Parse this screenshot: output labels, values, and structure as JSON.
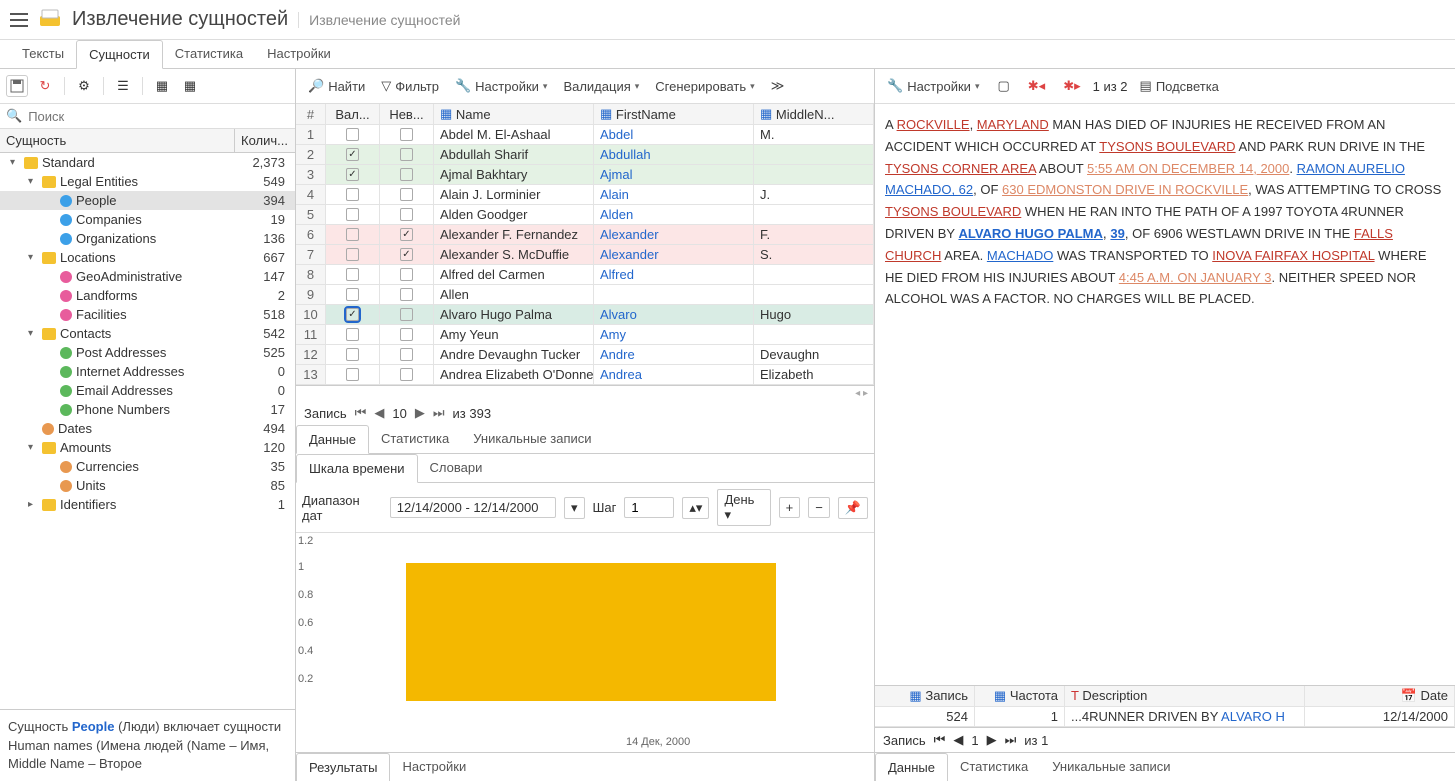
{
  "app": {
    "title": "Извлечение сущностей",
    "subtitle": "Извлечение сущностей"
  },
  "main_tabs": [
    "Тексты",
    "Сущности",
    "Статистика",
    "Настройки"
  ],
  "main_tab_active": 1,
  "sidebar": {
    "search_placeholder": "Поиск",
    "header_entity": "Сущность",
    "header_count": "Колич...",
    "tree": [
      {
        "indent": 0,
        "chev": "▾",
        "icon": "folder",
        "label": "Standard",
        "count": "2,373"
      },
      {
        "indent": 1,
        "chev": "▾",
        "icon": "folder",
        "label": "Legal Entities",
        "count": "549"
      },
      {
        "indent": 2,
        "chev": "",
        "icon": "dot",
        "color": "#3ca0e8",
        "label": "People",
        "count": "394",
        "sel": true
      },
      {
        "indent": 2,
        "chev": "",
        "icon": "dot",
        "color": "#3ca0e8",
        "label": "Companies",
        "count": "19"
      },
      {
        "indent": 2,
        "chev": "",
        "icon": "dot",
        "color": "#3ca0e8",
        "label": "Organizations",
        "count": "136"
      },
      {
        "indent": 1,
        "chev": "▾",
        "icon": "folder",
        "label": "Locations",
        "count": "667"
      },
      {
        "indent": 2,
        "chev": "",
        "icon": "dot",
        "color": "#e85c9c",
        "label": "GeoAdministrative",
        "count": "147"
      },
      {
        "indent": 2,
        "chev": "",
        "icon": "dot",
        "color": "#e85c9c",
        "label": "Landforms",
        "count": "2"
      },
      {
        "indent": 2,
        "chev": "",
        "icon": "dot",
        "color": "#e85c9c",
        "label": "Facilities",
        "count": "518"
      },
      {
        "indent": 1,
        "chev": "▾",
        "icon": "folder",
        "label": "Contacts",
        "count": "542"
      },
      {
        "indent": 2,
        "chev": "",
        "icon": "dot",
        "color": "#5cb85c",
        "label": "Post Addresses",
        "count": "525"
      },
      {
        "indent": 2,
        "chev": "",
        "icon": "dot",
        "color": "#5cb85c",
        "label": "Internet Addresses",
        "count": "0"
      },
      {
        "indent": 2,
        "chev": "",
        "icon": "dot",
        "color": "#5cb85c",
        "label": "Email Addresses",
        "count": "0"
      },
      {
        "indent": 2,
        "chev": "",
        "icon": "dot",
        "color": "#5cb85c",
        "label": "Phone Numbers",
        "count": "17"
      },
      {
        "indent": 1,
        "chev": "",
        "icon": "dot",
        "color": "#e89850",
        "label": "Dates",
        "count": "494"
      },
      {
        "indent": 1,
        "chev": "▾",
        "icon": "folder",
        "label": "Amounts",
        "count": "120"
      },
      {
        "indent": 2,
        "chev": "",
        "icon": "dot",
        "color": "#e89850",
        "label": "Currencies",
        "count": "35"
      },
      {
        "indent": 2,
        "chev": "",
        "icon": "dot",
        "color": "#e89850",
        "label": "Units",
        "count": "85"
      },
      {
        "indent": 1,
        "chev": "▸",
        "icon": "folder",
        "label": "Identifiers",
        "count": "1"
      }
    ],
    "desc_prefix": "Сущность ",
    "desc_keyword": "People",
    "desc_suffix": " (Люди) включает сущности Human names (Имена людей (Name – Имя, Middle Name – Второе"
  },
  "center_toolbar": {
    "find": "Найти",
    "filter": "Фильтр",
    "settings": "Настройки",
    "validation": "Валидация",
    "generate": "Сгенерировать"
  },
  "grid": {
    "headers": {
      "num": "#",
      "val": "Вал...",
      "nev": "Нев...",
      "name": "Name",
      "first": "FirstName",
      "mid": "MiddleN..."
    },
    "rows": [
      {
        "n": "1",
        "v": false,
        "nv": false,
        "name": "Abdel M. El-Ashaal",
        "first": "Abdel",
        "mid": "M.",
        "cls": ""
      },
      {
        "n": "2",
        "v": true,
        "nv": false,
        "name": "Abdullah Sharif",
        "first": "Abdullah",
        "mid": "",
        "cls": "greenish"
      },
      {
        "n": "3",
        "v": true,
        "nv": false,
        "name": "Ajmal Bakhtary",
        "first": "Ajmal",
        "mid": "",
        "cls": "greenish"
      },
      {
        "n": "4",
        "v": false,
        "nv": false,
        "name": "Alain J. Lorminier",
        "first": "Alain",
        "mid": "J.",
        "cls": ""
      },
      {
        "n": "5",
        "v": false,
        "nv": false,
        "name": "Alden Goodger",
        "first": "Alden",
        "mid": "",
        "cls": ""
      },
      {
        "n": "6",
        "v": false,
        "nv": true,
        "name": "Alexander F. Fernandez",
        "first": "Alexander",
        "mid": "F.",
        "cls": "pinkish"
      },
      {
        "n": "7",
        "v": false,
        "nv": true,
        "name": "Alexander S. McDuffie",
        "first": "Alexander",
        "mid": "S.",
        "cls": "pinkish"
      },
      {
        "n": "8",
        "v": false,
        "nv": false,
        "name": "Alfred del Carmen",
        "first": "Alfred",
        "mid": "",
        "cls": ""
      },
      {
        "n": "9",
        "v": false,
        "nv": false,
        "name": "Allen",
        "first": "",
        "mid": "",
        "cls": ""
      },
      {
        "n": "10",
        "v": true,
        "nv": false,
        "name": "Alvaro Hugo Palma",
        "first": "Alvaro",
        "mid": "Hugo",
        "cls": "sel"
      },
      {
        "n": "11",
        "v": false,
        "nv": false,
        "name": "Amy Yeun",
        "first": "Amy",
        "mid": "",
        "cls": ""
      },
      {
        "n": "12",
        "v": false,
        "nv": false,
        "name": "Andre Devaughn Tucker",
        "first": "Andre",
        "mid": "Devaughn",
        "cls": ""
      },
      {
        "n": "13",
        "v": false,
        "nv": false,
        "name": "Andrea Elizabeth O'Donnel",
        "first": "Andrea",
        "mid": "Elizabeth",
        "cls": ""
      }
    ],
    "pager_label": "Запись",
    "pager_pos": "10",
    "pager_total": "из 393"
  },
  "sub_tabs": [
    "Данные",
    "Статистика",
    "Уникальные записи"
  ],
  "tl_tabs": [
    "Шкала времени",
    "Словари"
  ],
  "timeline": {
    "range_label": "Диапазон дат",
    "range_value": "12/14/2000 - 12/14/2000",
    "step_label": "Шаг",
    "step_value": "1",
    "unit": "День",
    "xlabel": "14 Дек, 2000"
  },
  "chart_data": {
    "type": "bar",
    "categories": [
      "14 Дек, 2000"
    ],
    "values": [
      1
    ],
    "xlabel": "",
    "ylabel": "",
    "ylim": [
      0,
      1.2
    ],
    "yticks": [
      0.2,
      0.4,
      0.6,
      0.8,
      1,
      1.2
    ]
  },
  "result_tabs": [
    "Результаты",
    "Настройки"
  ],
  "right_toolbar": {
    "settings": "Настройки",
    "nav": "1 из 2",
    "highlight": "Подсветка"
  },
  "doc": {
    "t1": "A ",
    "l1": "ROCKVILLE",
    "t2": ", ",
    "l2": "MARYLAND",
    "t3": " MAN HAS DIED OF INJURIES HE RECEIVED FROM AN ACCIDENT WHICH OCCURRED AT ",
    "l3": "TYSONS BOULEVARD",
    "t4": " AND PARK RUN DRIVE IN THE ",
    "l4": "TYSONS CORNER AREA",
    "t5": " ABOUT ",
    "l5": "5:55 AM ON DECEMBER 14, 2000",
    "t6": ". ",
    "l6": "RAMON AURELIO MACHADO, 62",
    "t7": ", OF ",
    "l7": "630 EDMONSTON DRIVE IN ROCKVILLE",
    "t8": ", WAS ATTEMPTING TO CROSS ",
    "l8": "TYSONS BOULEVARD",
    "t9": " WHEN HE RAN INTO THE PATH OF A 1997 TOYOTA 4RUNNER DRIVEN BY ",
    "l9": "ALVARO HUGO PALMA",
    "l9b": "39",
    "t10": ", OF 6906 WESTLAWN DRIVE IN THE ",
    "l10": "FALLS CHURCH",
    "t11": " AREA. ",
    "l11": "MACHADO",
    "t12": " WAS TRANSPORTED TO ",
    "l12": "INOVA FAIRFAX HOSPITAL",
    "t13": " WHERE HE DIED FROM HIS INJURIES ABOUT ",
    "l13": "4:45 A.M. ON JANUARY 3",
    "t14": ". NEITHER SPEED NOR ALCOHOL WAS A FACTOR. NO CHARGES WILL BE PLACED."
  },
  "facts": {
    "headers": {
      "rec": "Запись",
      "freq": "Частота",
      "desc": "Description",
      "date": "Date"
    },
    "row": {
      "rec": "524",
      "freq": "1",
      "desc": "...4RUNNER DRIVEN BY ",
      "desc_link": "ALVARO H",
      "date": "12/14/2000"
    },
    "pager_label": "Запись",
    "pager_pos": "1",
    "pager_total": "из 1"
  },
  "right_sub_tabs": [
    "Данные",
    "Статистика",
    "Уникальные записи"
  ]
}
